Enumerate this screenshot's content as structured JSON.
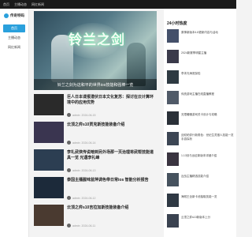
{
  "topbar": {
    "items": [
      "首页",
      "主播动态",
      "网红新闻"
    ]
  },
  "sidebar": {
    "logo_text": "传奇特码",
    "items": [
      {
        "label": "首页",
        "active": true
      },
      {
        "label": "主播动态",
        "active": false
      },
      {
        "label": "网红新闻",
        "active": false
      }
    ]
  },
  "banner": {
    "art_title": "铃兰之剑",
    "caption": "铃兰之剑为这和平的世界ios技能和强棒一览",
    "tab1": "主播动态",
    "tab2": "网红新闻"
  },
  "articles": [
    {
      "title": "巨人日本谍报潜伏日本文化复苏：探讨在云计算环境中的应用优势",
      "author": "admin",
      "date": "2024-06-15",
      "thumb": "#2a2a2a"
    },
    {
      "title": "云顶之弈s10贾克斯技能装备介绍",
      "author": "admin",
      "date": "2024-06-14",
      "thumb": "#3a3550"
    },
    {
      "title": "李礼武侠传说暗到另外场那一页治理将武帮技能道具一览 光遇李礼峰",
      "author": "admin",
      "date": "2024-06-13",
      "thumb": "#2c3e52"
    },
    {
      "title": "泰国主播腥味蓝萍调色带日常ios  智能分析报告",
      "author": "admin",
      "date": "2024-06-12",
      "thumb": "#1c2a3a"
    },
    {
      "title": "云顶之弈s10吉拉加斯技能装备介绍",
      "author": "admin",
      "date": "2024-06-11",
      "thumb": "#4a3a30"
    }
  ],
  "right": {
    "title": "24小时热度",
    "items": [
      {
        "text": "原神新版本4.8更新内容与活动",
        "thumb": "#44506a"
      },
      {
        "text": "2024新赛季明星主播",
        "thumb": "#3a3a4a"
      },
      {
        "text": "李沐光海底探险",
        "thumb": "#2e3a42"
      },
      {
        "text": "传统游戏主播在线直播教程",
        "thumb": "#505a68"
      },
      {
        "text": "无限暖暖游戏关卡设计与攻略",
        "thumb": "#2a3038"
      },
      {
        "text": "战双帕弥什新角色：世纪生灵猎人技能一览 手游探析",
        "thumb": "#3c4654"
      },
      {
        "text": "1.13剑与远征新版本详细介绍",
        "thumb": "#3a3440"
      },
      {
        "text": "近战主播精选技能介绍",
        "thumb": "#46525e"
      },
      {
        "text": "海贼王全新卡池抽取技能一览",
        "thumb": "#2f3944"
      },
      {
        "text": "云顶之弈s10新版本上分",
        "thumb": "#3a4250"
      }
    ]
  }
}
